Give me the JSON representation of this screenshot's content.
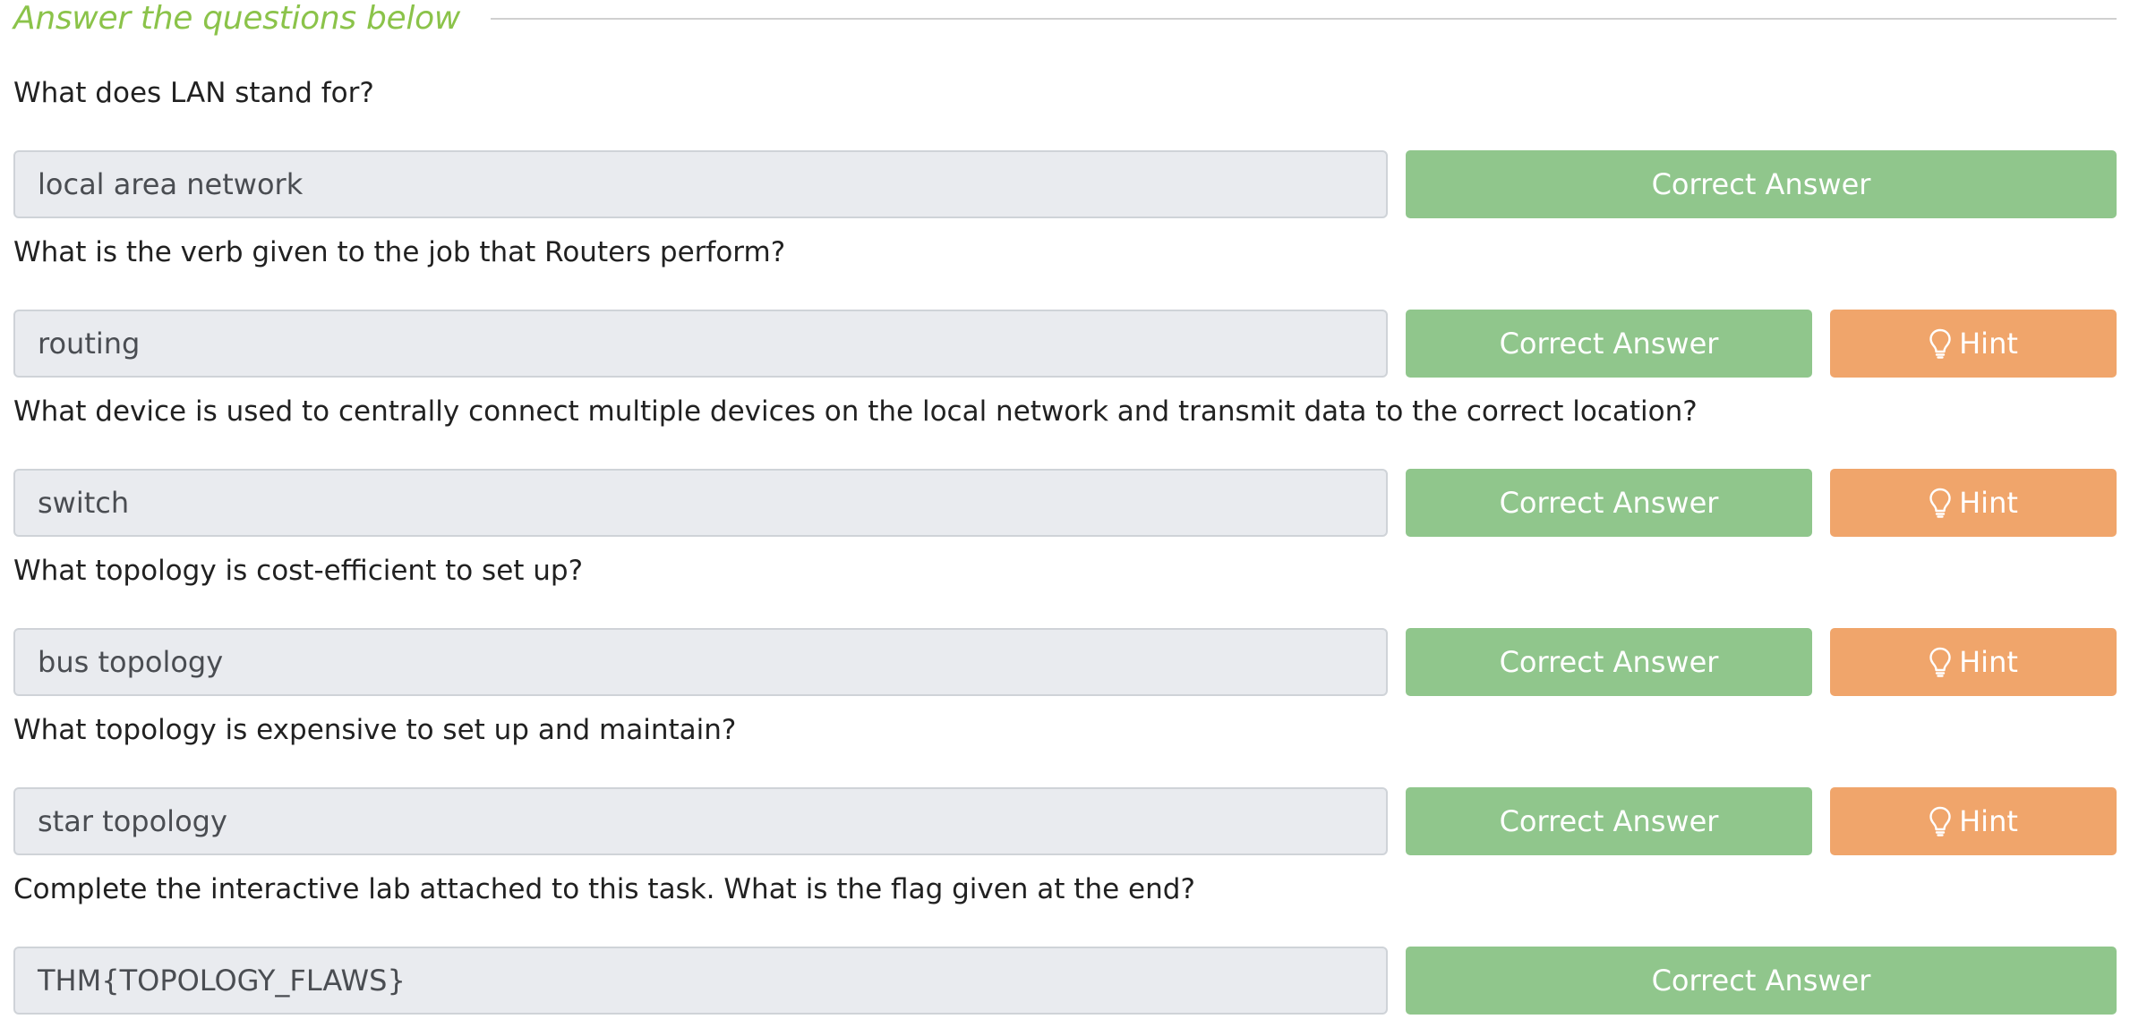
{
  "section": {
    "title": "Answer the questions below"
  },
  "colors": {
    "title_green": "#8bc34a",
    "correct_green": "#90c68c",
    "hint_orange": "#f0a56b",
    "field_bg": "#e9ebef"
  },
  "questions": [
    {
      "question": "What does LAN stand for?",
      "answer": "local area network",
      "status_label": "Correct Answer"
    },
    {
      "question": "What is the verb given to the job that Routers perform?",
      "answer": "routing",
      "status_label": "Correct Answer",
      "hint_label": "Hint",
      "hint_icon": "lightbulb-icon"
    },
    {
      "question": "What device is used to centrally connect multiple devices on the local network and transmit data to the correct location?",
      "answer": "switch",
      "status_label": "Correct Answer",
      "hint_label": "Hint",
      "hint_icon": "lightbulb-icon"
    },
    {
      "question": "What topology is cost-efficient to set up?",
      "answer": "bus topology",
      "status_label": "Correct Answer",
      "hint_label": "Hint",
      "hint_icon": "lightbulb-icon"
    },
    {
      "question": "What topology is expensive to set up and maintain?",
      "answer": "star topology",
      "status_label": "Correct Answer",
      "hint_label": "Hint",
      "hint_icon": "lightbulb-icon"
    },
    {
      "question": "Complete the interactive lab attached to this task. What is the flag given at the end?",
      "answer": "THM{TOPOLOGY_FLAWS}",
      "status_label": "Correct Answer"
    }
  ]
}
